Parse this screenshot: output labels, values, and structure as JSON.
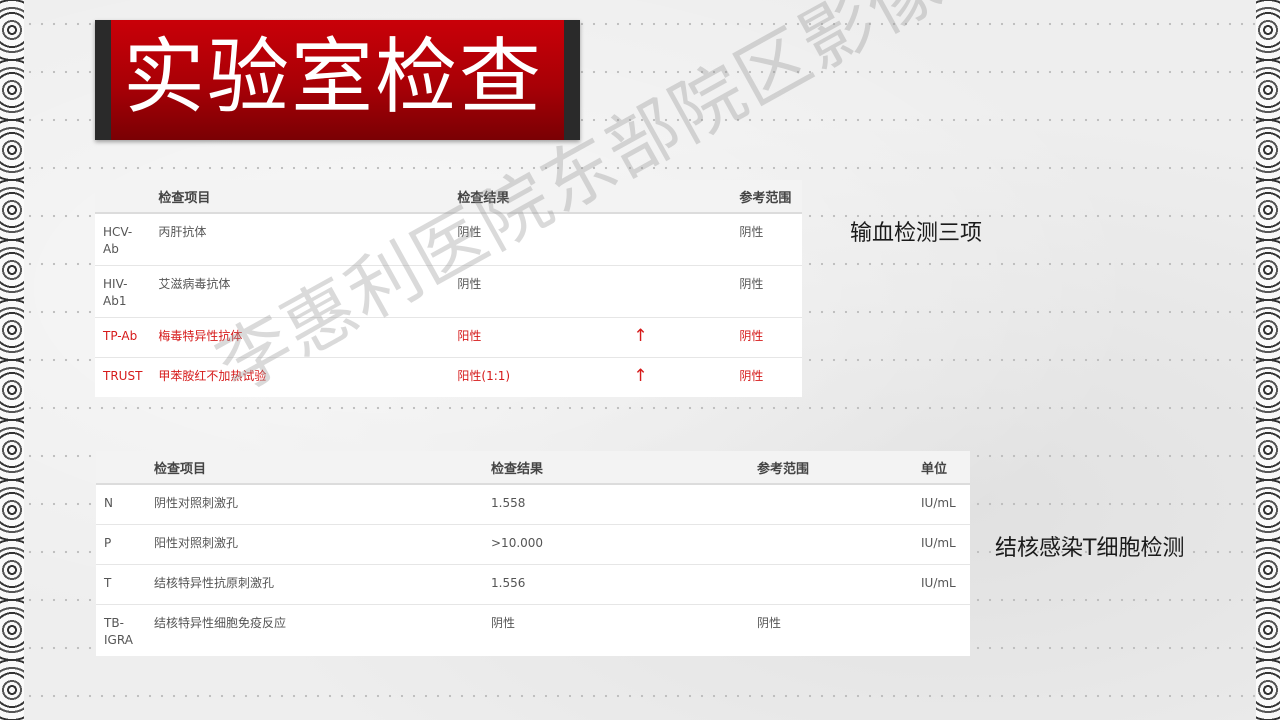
{
  "title": "实验室检查",
  "watermark": "李惠利医院东部院区影像科",
  "section1": {
    "label": "输血检测三项",
    "headers": [
      "检查项目",
      "检查结果",
      "参考范围"
    ],
    "rows": [
      {
        "code": "HCV-Ab",
        "name": "丙肝抗体",
        "result": "阴性",
        "arrow": "",
        "ref": "阴性"
      },
      {
        "code": "HIV-Ab1",
        "name": "艾滋病毒抗体",
        "result": "阴性",
        "arrow": "",
        "ref": "阴性"
      },
      {
        "code": "TP-Ab",
        "name": "梅毒特异性抗体",
        "result": "阳性",
        "arrow": "↑",
        "ref": "阴性"
      },
      {
        "code": "TRUST",
        "name": "甲苯胺红不加热试验",
        "result": "阳性(1:1)",
        "arrow": "↑",
        "ref": "阴性"
      }
    ]
  },
  "section2": {
    "label": "结核感染T细胞检测",
    "headers": [
      "检查项目",
      "检查结果",
      "参考范围",
      "单位"
    ],
    "rows": [
      {
        "code": "N",
        "name": "阴性对照刺激孔",
        "result": "1.558",
        "ref": "",
        "unit": "IU/mL"
      },
      {
        "code": "P",
        "name": "阳性对照刺激孔",
        "result": ">10.000",
        "ref": "",
        "unit": "IU/mL"
      },
      {
        "code": "T",
        "name": "结核特异性抗原刺激孔",
        "result": "1.556",
        "ref": "",
        "unit": "IU/mL"
      },
      {
        "code": "TB-IGRA",
        "name": "结核特异性细胞免疫反应",
        "result": "阴性",
        "ref": "阴性",
        "unit": ""
      }
    ]
  },
  "colors": {
    "banner": "#c90008",
    "abnormal": "#d61a1a"
  }
}
